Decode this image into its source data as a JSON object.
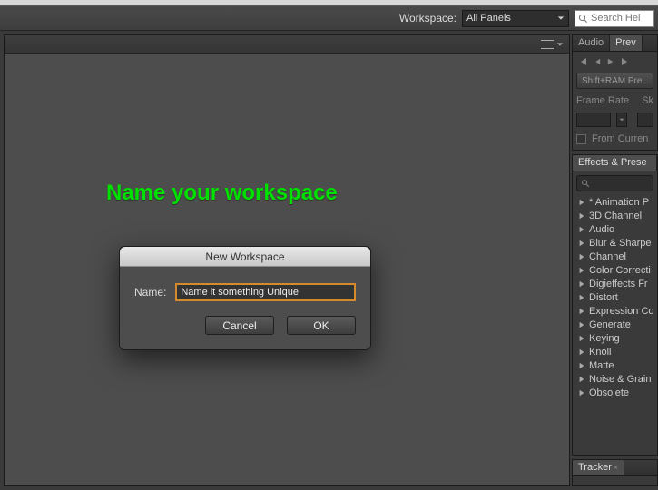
{
  "toolbar": {
    "workspace_label": "Workspace:",
    "workspace_value": "All Panels",
    "search_placeholder": "Search Hel"
  },
  "overlay": {
    "instruction": "Name your workspace"
  },
  "dialog": {
    "title": "New Workspace",
    "name_label": "Name:",
    "name_value": "Name it something Unique",
    "cancel_label": "Cancel",
    "ok_label": "OK"
  },
  "preview_panel": {
    "tabs": [
      "Audio",
      "Prev"
    ],
    "shift_ram_label": "Shift+RAM Pre",
    "frame_rate_label": "Frame Rate",
    "skip_label": "Sk",
    "from_current_label": "From Curren"
  },
  "effects_panel": {
    "title": "Effects & Prese",
    "items": [
      "* Animation P",
      "3D Channel",
      "Audio",
      "Blur & Sharpe",
      "Channel",
      "Color Correcti",
      "Digieffects Fr",
      "Distort",
      "Expression Co",
      "Generate",
      "Keying",
      "Knoll",
      "Matte",
      "Noise & Grain",
      "Obsolete"
    ]
  },
  "tracker_panel": {
    "title": "Tracker"
  }
}
